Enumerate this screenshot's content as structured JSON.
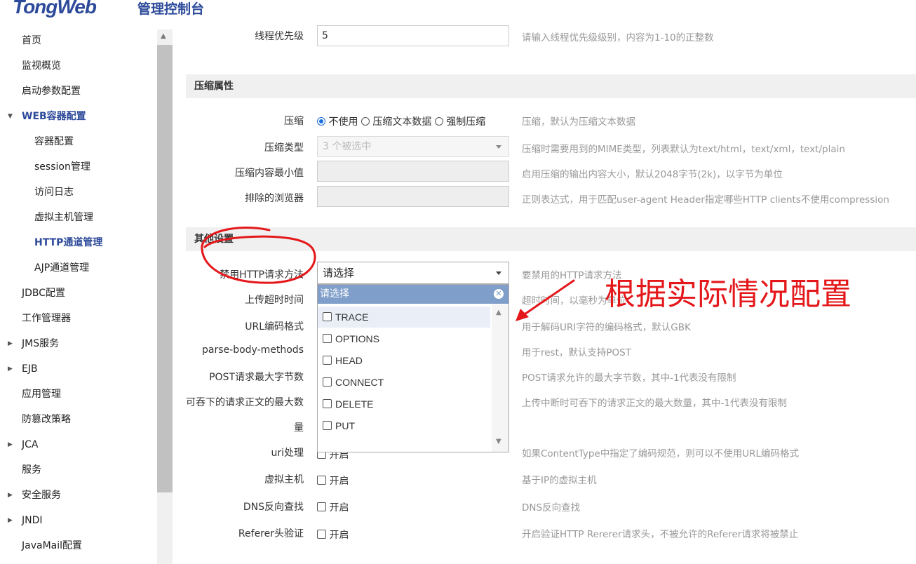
{
  "header": {
    "logo": "TongWeb",
    "subtitle": "管理控制台"
  },
  "sidebar": {
    "items": [
      {
        "label": "首页"
      },
      {
        "label": "监视概览"
      },
      {
        "label": "启动参数配置"
      },
      {
        "label": "WEB容器配置"
      },
      {
        "label": "容器配置"
      },
      {
        "label": "session管理"
      },
      {
        "label": "访问日志"
      },
      {
        "label": "虚拟主机管理"
      },
      {
        "label": "HTTP通道管理"
      },
      {
        "label": "AJP通道管理"
      },
      {
        "label": "JDBC配置"
      },
      {
        "label": "工作管理器"
      },
      {
        "label": "JMS服务"
      },
      {
        "label": "EJB"
      },
      {
        "label": "应用管理"
      },
      {
        "label": "防篡改策略"
      },
      {
        "label": "JCA"
      },
      {
        "label": "服务"
      },
      {
        "label": "安全服务"
      },
      {
        "label": "JNDI"
      },
      {
        "label": "JavaMail配置"
      }
    ]
  },
  "thread": {
    "label": "线程优先级",
    "value": "5",
    "hint": "请输入线程优先级级别，内容为1-10的正整数"
  },
  "compression": {
    "section_title": "压缩属性",
    "compress": {
      "label": "压缩",
      "options": [
        "不使用",
        "压缩文本数据",
        "强制压缩"
      ],
      "selected": "不使用",
      "hint": "压缩，默认为压缩文本数据"
    },
    "type": {
      "label": "压缩类型",
      "value": "3 个被选中",
      "hint": "压缩时需要用到的MIME类型，列表默认为text/html，text/xml，text/plain"
    },
    "min_size": {
      "label": "压缩内容最小值",
      "hint": "启用压缩的输出内容大小，默认2048字节(2k)，以字节为单位"
    },
    "excluded": {
      "label": "排除的浏览器",
      "hint": "正则表达式，用于匹配user-agent Header指定哪些HTTP clients不使用compression"
    }
  },
  "other": {
    "section_title": "其他设置",
    "forbid_methods": {
      "label": "禁用HTTP请求方法",
      "value": "请选择",
      "hint": "要禁用的HTTP请求方法"
    },
    "upload_timeout": {
      "label": "上传超时时间",
      "hint": "超时时间，以毫秒为单位"
    },
    "url_encoding": {
      "label": "URL编码格式",
      "hint": "用于解码URI字符的编码格式，默认GBK"
    },
    "parse_body": {
      "label": "parse-body-methods",
      "hint": "用于rest，默认支持POST"
    },
    "post_max": {
      "label": "POST请求最大字节数",
      "hint": "POST请求允许的最大字节数，其中-1代表没有限制"
    },
    "swallow_1": {
      "label": "可吞下的请求正文的最大数",
      "hint": "上传中断时可吞下的请求正文的最大数量，其中-1代表没有限制"
    },
    "swallow_2": {
      "label": "量"
    },
    "uri": {
      "label": "uri处理",
      "option": "开启",
      "hint": "如果ContentType中指定了编码规范，则可以不使用URL编码格式"
    },
    "vhost": {
      "label": "虚拟主机",
      "option": "开启",
      "hint": "基于IP的虚拟主机"
    },
    "dns": {
      "label": "DNS反向查找",
      "option": "开启",
      "hint": "DNS反向查找"
    },
    "referer": {
      "label": "Referer头验证",
      "option": "开启",
      "hint": "开启验证HTTP Rererer请求头，不被允许的Referer请求将被禁止"
    }
  },
  "dropdown": {
    "header": "请选择",
    "options": [
      "TRACE",
      "OPTIONS",
      "HEAD",
      "CONNECT",
      "DELETE",
      "PUT"
    ],
    "highlighted": "TRACE"
  },
  "annotation": {
    "text": "根据实际情况配置",
    "color": "#e4181b"
  },
  "colors": {
    "brand": "#2d4a9a",
    "dropdown_header": "#7f9ec9",
    "radio_selected": "#1a6ee0"
  }
}
